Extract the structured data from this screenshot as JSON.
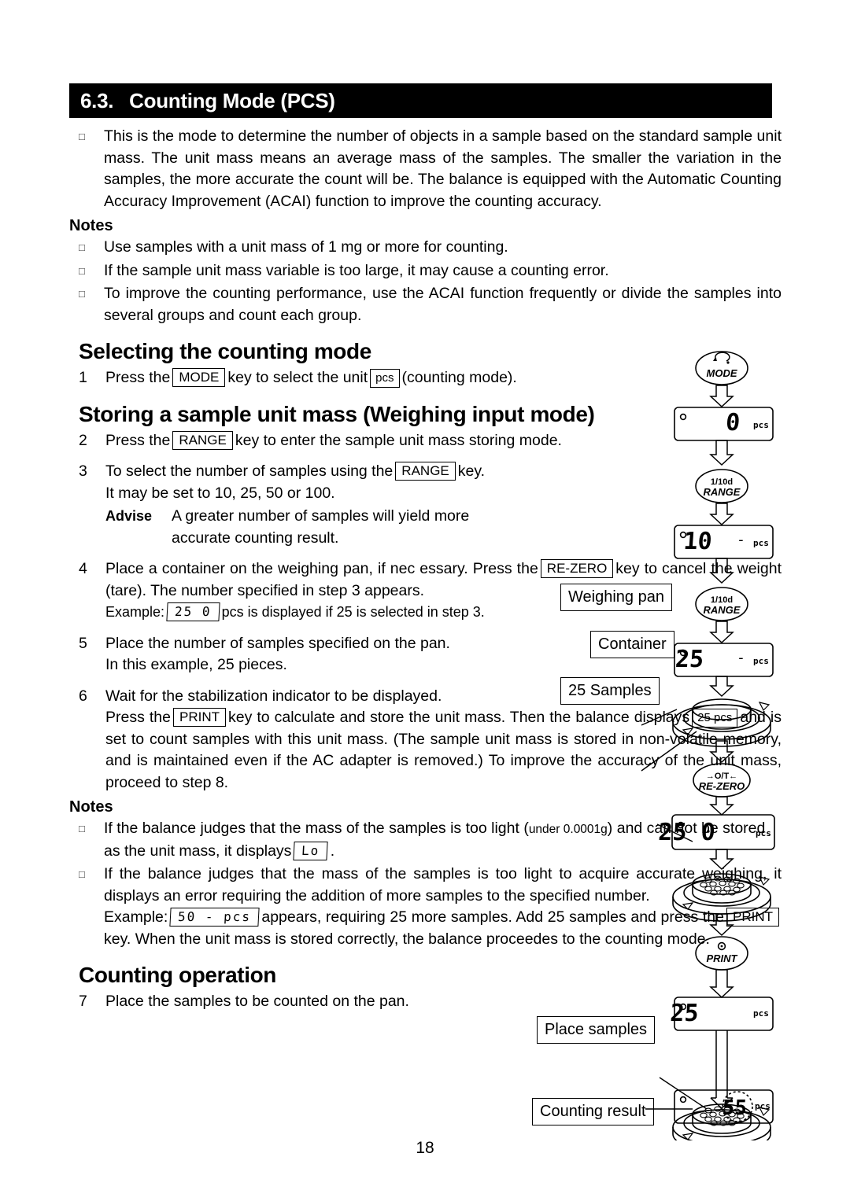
{
  "header": {
    "number": "6.3.",
    "title": "Counting Mode (PCS)"
  },
  "intro": {
    "bullet_glyph": "□",
    "text": "This is the mode to determine the number of objects in a sample based on the standard sample unit mass. The unit mass means an average mass of the samples. The smaller the variation in the samples, the more accurate the count will be. The balance is equipped with the Automatic Counting Accuracy Improvement (ACAI) function to improve the counting accuracy."
  },
  "notes1": {
    "heading": "Notes",
    "items": [
      "Use samples with a unit mass of 1 mg or more for counting.",
      "If the sample unit mass variable is too large, it may cause a counting error.",
      "To improve the counting performance, use the ACAI function frequently or divide the samples into several groups and count each group."
    ]
  },
  "section_selecting": {
    "heading": "Selecting the counting mode",
    "step1": {
      "num": "1",
      "a": "Press the",
      "key_mode": "MODE",
      "b": "key to select the unit",
      "key_pcs": "pcs",
      "c": "(counting mode)."
    }
  },
  "section_storing": {
    "heading": "Storing a sample unit mass (Weighing input mode)",
    "step2": {
      "num": "2",
      "a": "Press the",
      "key_range": "RANGE",
      "b": "key to enter the sample unit mass storing mode."
    },
    "step3": {
      "num": "3",
      "a": "To select the number of samples using the",
      "key_range": "RANGE",
      "b": "key.",
      "line2": "It may be set to 10, 25, 50 or 100.",
      "advise_label": "Advise",
      "advise_text": "A greater number of samples will yield more",
      "advise_text2": "accurate counting result."
    },
    "step4": {
      "num": "4",
      "a": "Place a container on the weighing pan, if nec essary. Press the",
      "key_rezero": "RE-ZERO",
      "b": "key to cancel the weight (tare). The number specified in step 3 appears.",
      "example_label": "Example:",
      "example_lcd": "25 0",
      "example_tail": "pcs is displayed if 25 is selected in step 3."
    },
    "step5": {
      "num": "5",
      "line1": "Place the number of samples specified on the pan.",
      "line2": "In this example, 25 pieces."
    },
    "step6": {
      "num": "6",
      "line1": "Wait for the stabilization indicator to be displayed.",
      "a": "Press the",
      "key_print": "PRINT",
      "b": "key to calculate and store the unit mass. Then the balance displays",
      "key_25pcs": "25 pcs",
      "c": "and is set to count samples with this unit mass. (The sample unit mass is stored in non-volatile memory, and is maintained even if the AC adapter is removed.) To improve the accuracy of the unit mass, proceed to step 8."
    }
  },
  "notes2": {
    "heading": "Notes",
    "item1": {
      "a": "If the balance judges that the mass of the samples is too light",
      "paren_open": "(",
      "small": "under 0.0001g",
      "paren_close": ")",
      "b": "and can not be stored as the unit mass, it displays",
      "lcd": "Lo",
      "c": "."
    },
    "item2": {
      "a": "If the balance judges that the mass of the samples is too light to acquire accurate weighing, it displays an error requiring the addition of more samples to the specified number.",
      "example_label": "Example:",
      "example_lcd": "50 - pcs",
      "b": "appears, requiring 25 more samples. Add 25 samples and press the",
      "key_print": "PRINT",
      "c": "key. When the unit mass is stored correctly, the balance proceedes to the counting mode."
    }
  },
  "section_counting": {
    "heading": "Counting operation",
    "step7": {
      "num": "7",
      "text": "Place the samples to be counted on the pan."
    }
  },
  "page_number": "18",
  "diagram": {
    "keys": [
      {
        "name": "mode-key",
        "icon": "circular-arrow-icon",
        "label": "MODE"
      },
      {
        "name": "range-key-1",
        "sublabel": "1/10d",
        "label": "RANGE"
      },
      {
        "name": "range-key-2",
        "sublabel": "1/10d",
        "label": "RANGE"
      },
      {
        "name": "rezero-key",
        "sublabel": "→O/T←",
        "label": "RE-ZERO"
      },
      {
        "name": "print-key",
        "icon": "print-icon",
        "label": "PRINT"
      }
    ],
    "displays": [
      {
        "name": "display-0",
        "value": "0",
        "unit": "pcs",
        "dash": ""
      },
      {
        "name": "display-10",
        "value": "10",
        "unit": "pcs",
        "dash": "-"
      },
      {
        "name": "display-25",
        "value": "25",
        "unit": "pcs",
        "dash": "-"
      },
      {
        "name": "display-25-0",
        "value": "25 0",
        "unit": "pcs",
        "dash": ""
      },
      {
        "name": "display-25-pcs",
        "value": "25",
        "unit": "pcs",
        "dash": ""
      },
      {
        "name": "display-result-55",
        "value": "55",
        "unit": "pcs",
        "dash": ""
      }
    ],
    "callouts": [
      {
        "name": "callout-weighing-pan",
        "label": "Weighing pan"
      },
      {
        "name": "callout-container",
        "label": "Container"
      },
      {
        "name": "callout-25-samples",
        "label": "25 Samples"
      },
      {
        "name": "callout-place-samples",
        "label": "Place samples"
      },
      {
        "name": "callout-counting-result",
        "label": "Counting result"
      }
    ]
  },
  "colors": {
    "header_bg": "#000000",
    "header_fg": "#ffffff",
    "page_bg": "#ffffff",
    "ink": "#000000"
  }
}
